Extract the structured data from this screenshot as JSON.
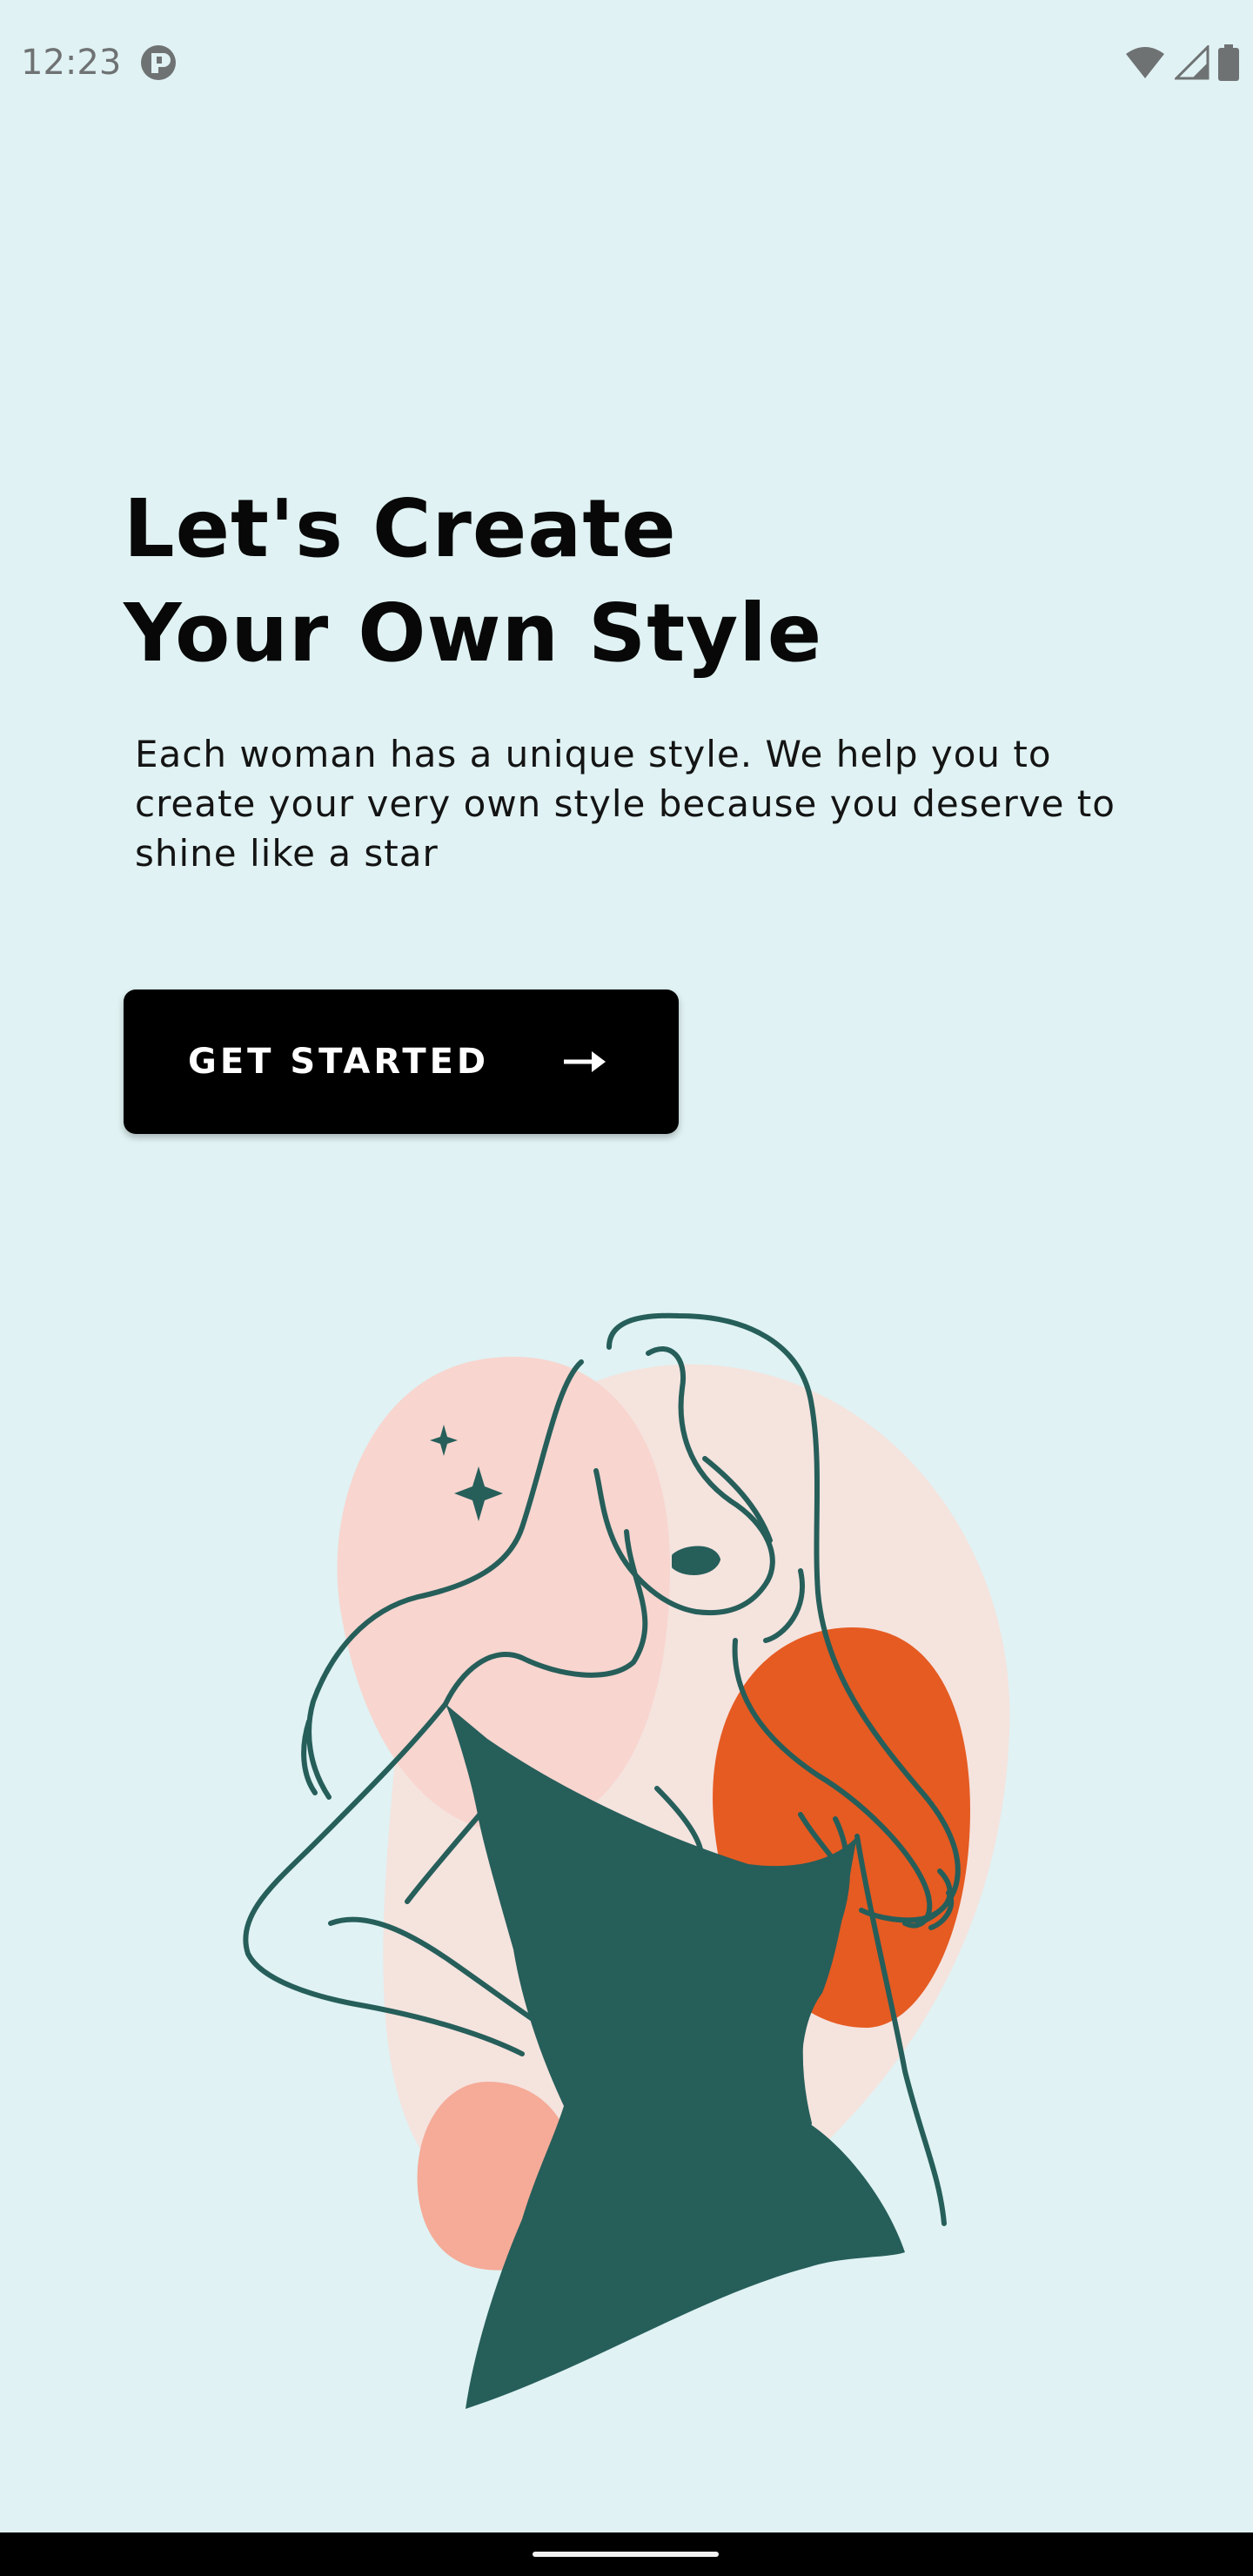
{
  "status_bar": {
    "time": "12:23",
    "app_icon": "notification-app-icon",
    "icons": [
      "wifi-icon",
      "cellular-signal-icon",
      "battery-icon"
    ]
  },
  "hero": {
    "title_line_1": "Let's Create",
    "title_line_2": "Your Own Style",
    "description": "Each woman has a unique style. We help you to create your very own style because you deserve to shine like a star"
  },
  "cta": {
    "label": "GET STARTED",
    "icon": "arrow-right-icon"
  },
  "illustration": {
    "subject": "woman-fashion-illustration",
    "colors": {
      "dress": "#265e5a",
      "blob_pink": "#f8d5cf",
      "blob_light": "#f5e3de",
      "blob_orange": "#e55b22",
      "blob_salmon": "#f5ab98",
      "line": "#265e5a"
    }
  },
  "theme": {
    "background": "#e0f2f3",
    "button_bg": "#000000",
    "button_text": "#ffffff"
  }
}
